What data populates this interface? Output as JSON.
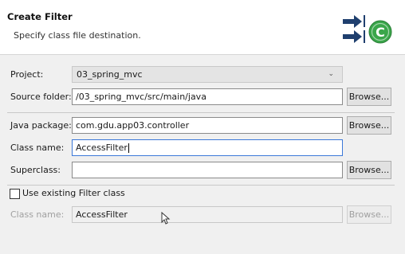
{
  "header": {
    "title": "Create Filter",
    "description": "Specify class file destination.",
    "wizard_graphic": "new-filter-wizard-icon"
  },
  "form": {
    "project": {
      "label": "Project:",
      "value": "03_spring_mvc"
    },
    "source_folder": {
      "label": "Source folder:",
      "value": "/03_spring_mvc/src/main/java",
      "button": "Browse..."
    },
    "java_package": {
      "label": "Java package:",
      "value": "com.gdu.app03.controller",
      "button": "Browse..."
    },
    "class_name": {
      "label": "Class name:",
      "value": "AccessFilter"
    },
    "superclass": {
      "label": "Superclass:",
      "value": "",
      "button": "Browse..."
    },
    "use_existing": {
      "label": "Use existing Filter class",
      "checked": false
    },
    "existing_class_name": {
      "label": "Class name:",
      "value": "AccessFilter",
      "button": "Browse..."
    }
  },
  "colors": {
    "accent_green": "#3aa64a",
    "arrow_blue": "#1f3f6e",
    "focus_border": "#3c78d8"
  }
}
